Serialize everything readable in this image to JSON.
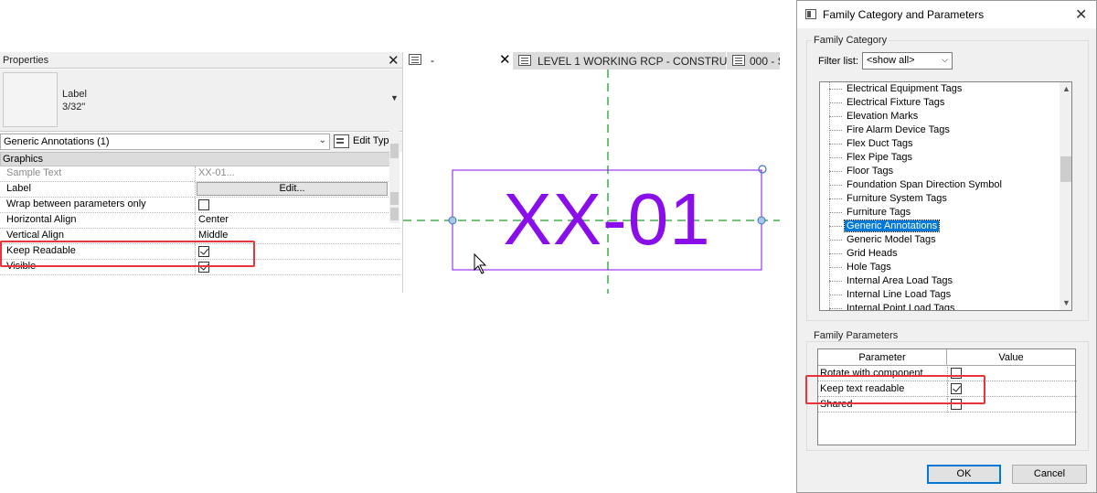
{
  "properties": {
    "title": "Properties",
    "type_name_line1": "Label",
    "type_name_line2": "3/32\"",
    "instance_filter": "Generic Annotations (1)",
    "edit_type_label": "Edit Type",
    "group_graphics": "Graphics",
    "rows": [
      {
        "name": "Sample Text",
        "value": "XX-01..."
      },
      {
        "name": "Label",
        "button": "Edit..."
      },
      {
        "name": "Wrap between parameters only",
        "checked": false
      },
      {
        "name": "Horizontal Align",
        "value": "Center"
      },
      {
        "name": "Vertical Align",
        "value": "Middle"
      },
      {
        "name": "Keep Readable",
        "checked": true
      },
      {
        "name": "Visible",
        "checked": true
      }
    ]
  },
  "view_tabs": {
    "first_label": "-",
    "active_label": "LEVEL 1 WORKING RCP - CONSTRU...",
    "next_label": "000 - S"
  },
  "canvas": {
    "label_text": "XX-01",
    "label_color": "#8a0eea",
    "ref_line_color": "#1f9e2e"
  },
  "dialog": {
    "title": "Family Category and Parameters",
    "family_category_legend": "Family Category",
    "filter_label": "Filter list:",
    "filter_value": "<show all>",
    "categories": [
      "Electrical Equipment Tags",
      "Electrical Fixture Tags",
      "Elevation Marks",
      "Fire Alarm Device Tags",
      "Flex Duct Tags",
      "Flex Pipe Tags",
      "Floor Tags",
      "Foundation Span Direction Symbol",
      "Furniture System Tags",
      "Furniture Tags",
      "Generic Annotations",
      "Generic Model Tags",
      "Grid Heads",
      "Hole Tags",
      "Internal Area Load Tags",
      "Internal Line Load Tags",
      "Internal Point Load Tags"
    ],
    "selected_category": "Generic Annotations",
    "family_parameters_legend": "Family Parameters",
    "col_parameter": "Parameter",
    "col_value": "Value",
    "params": [
      {
        "name": "Rotate with component",
        "checked": false
      },
      {
        "name": "Keep text readable",
        "checked": true
      },
      {
        "name": "Shared",
        "checked": false
      }
    ],
    "ok_label": "OK",
    "cancel_label": "Cancel"
  },
  "highlight_color": "#e8343a"
}
